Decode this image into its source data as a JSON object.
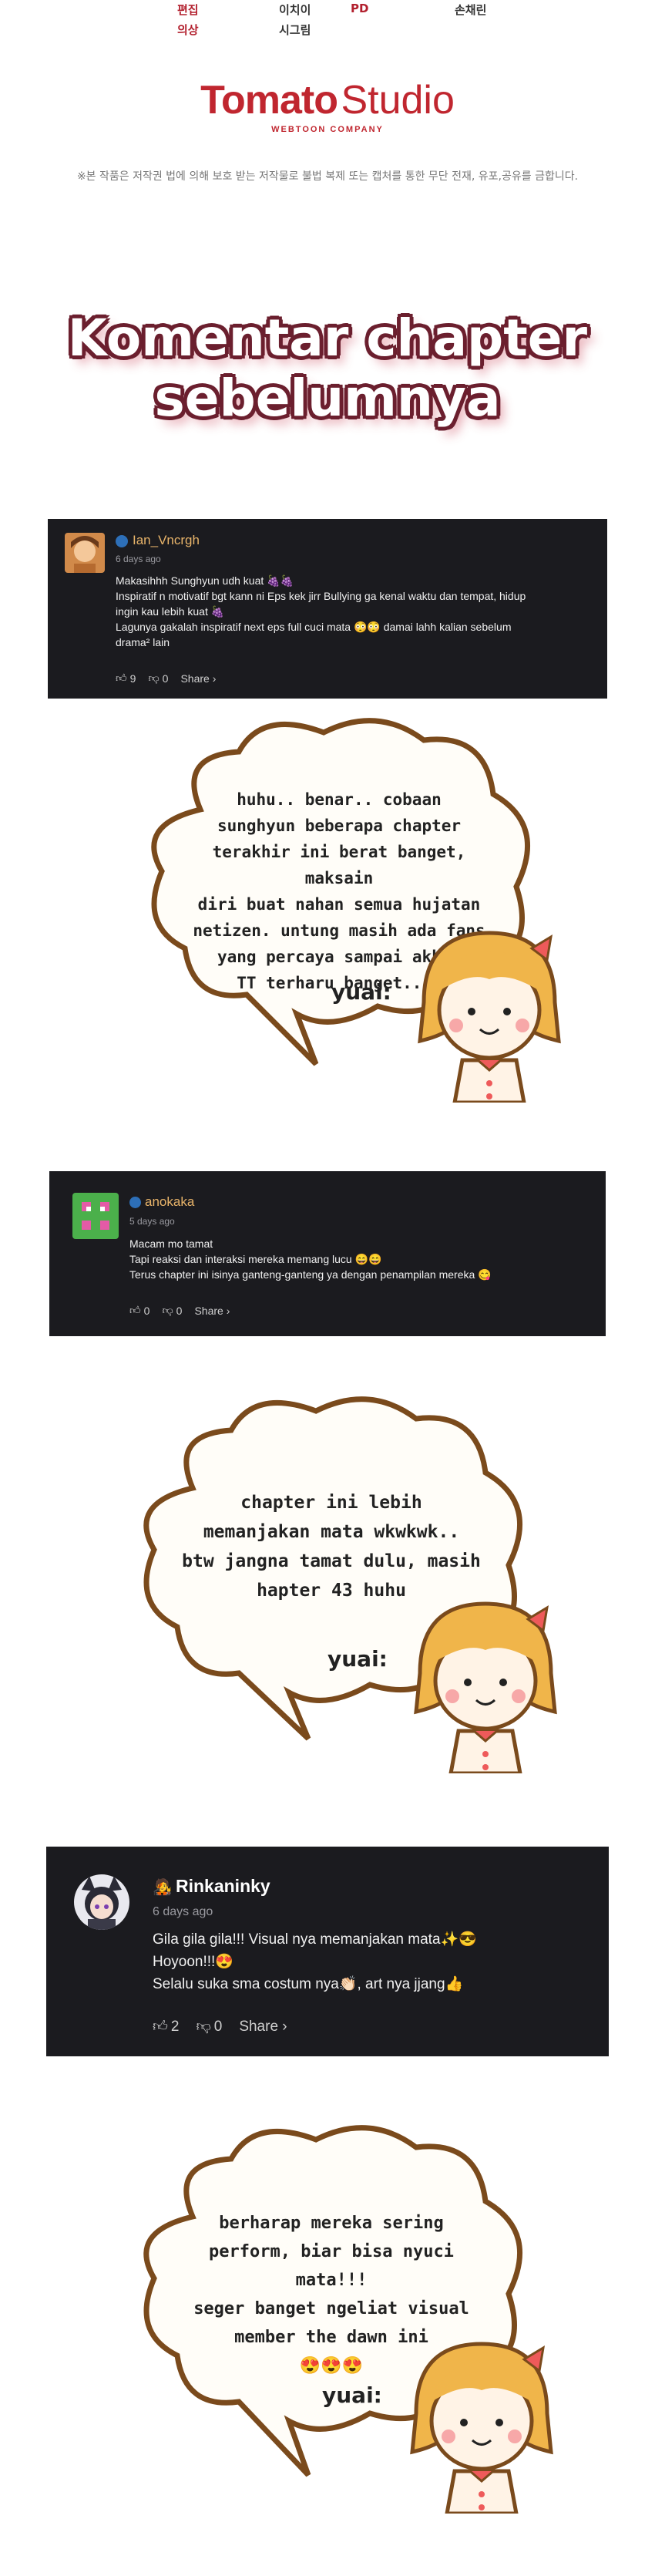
{
  "credits": {
    "col1": [
      "편집",
      "의상"
    ],
    "col2": [
      "이치이",
      "시그림"
    ],
    "col3": [
      "PD"
    ],
    "col4": [
      "손채린"
    ]
  },
  "logo": {
    "word1": "Tomato",
    "word2": "Studio",
    "sub": "WEBTOON COMPANY"
  },
  "notice": "※본 작품은 저작권 법에 의해 보호 받는 저작물로 불법 복제 또는 캡처를 통한 무단 전재, 유포,공유를 금합니다.",
  "headline": {
    "line1": "Komentar chapter",
    "line2": "sebelumnya"
  },
  "comments": [
    {
      "username": "Ian_Vncrgh",
      "time": "6 days ago",
      "lines": [
        "Makasihhh Sunghyun udh kuat 🍇🍇",
        "Inspiratif n motivatif bgt kann ni Eps kek jirr Bullying ga kenal waktu dan tempat, hidup",
        "ingin kau lebih kuat 🍇",
        "Lagunya gakalah inspiratif next eps full cuci mata 😳😳 damai lahh kalian sebelum",
        "drama² lain"
      ],
      "likes": "9",
      "dislikes": "0",
      "share": "Share ›"
    },
    {
      "username": "anokaka",
      "time": "5 days ago",
      "lines": [
        "Macam mo tamat",
        "Tapi reaksi dan interaksi mereka memang lucu 😄😄",
        "Terus chapter ini isinya ganteng-ganteng ya dengan penampilan mereka 😋"
      ],
      "likes": "0",
      "dislikes": "0",
      "share": "Share ›"
    },
    {
      "username": "Rinkaninky",
      "time": "6 days ago",
      "lines": [
        "Gila gila gila!!! Visual nya memanjakan mata✨😎",
        "Hoyoon!!!😍",
        "Selalu suka sma costum nya👏🏻, art nya jjang👍"
      ],
      "likes": "2",
      "dislikes": "0",
      "share": "Share ›"
    }
  ],
  "replies": [
    {
      "lines": [
        "huhu.. benar.. cobaan",
        "sunghyun beberapa chapter",
        "terakhir ini berat banget, maksain",
        "diri buat nahan semua hujatan",
        "netizen. untung masih ada fans",
        "yang percaya sampai akhir",
        "TT terharu banget...."
      ],
      "signature": "yuai:"
    },
    {
      "lines": [
        "chapter ini lebih",
        "memanjakan mata wkwkwk..",
        "btw jangna tamat dulu, masih",
        "hapter 43 huhu"
      ],
      "signature": "yuai:"
    },
    {
      "lines": [
        "berharap mereka sering",
        "perform, biar bisa nyuci mata!!!",
        "seger banget ngeliat visual",
        "member the dawn ini",
        "😍😍😍"
      ],
      "signature": "yuai:"
    }
  ],
  "colors": {
    "brand": "#c0262f",
    "panel": "#1b1b1f",
    "username": "#e8b46a",
    "bubble_outline": "#7a4a1c"
  }
}
